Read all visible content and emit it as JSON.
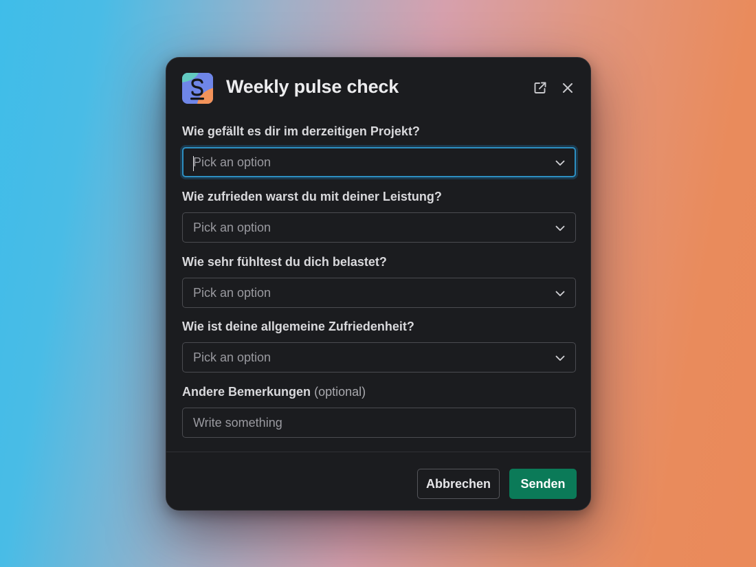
{
  "modal": {
    "title": "Weekly pulse check",
    "app_icon": "s-app-logo",
    "external_icon": "external-link-icon",
    "close_icon": "close-icon"
  },
  "fields": [
    {
      "label": "Wie gefällt es dir im derzeitigen Projekt?",
      "placeholder": "Pick an option",
      "focused": true
    },
    {
      "label": "Wie zufrieden warst du mit deiner Leistung?",
      "placeholder": "Pick an option"
    },
    {
      "label": "Wie sehr fühltest du dich belastet?",
      "placeholder": "Pick an option"
    },
    {
      "label": "Wie ist deine allgemeine Zufriedenheit?",
      "placeholder": "Pick an option"
    }
  ],
  "comments": {
    "label": "Andere Bemerkungen",
    "optional": "(optional)",
    "placeholder": "Write something"
  },
  "footer": {
    "cancel_label": "Abbrechen",
    "submit_label": "Senden"
  },
  "colors": {
    "modal_bg": "#1b1c1f",
    "focus_ring": "#2d8fc2",
    "primary_button": "#0b7a58"
  }
}
